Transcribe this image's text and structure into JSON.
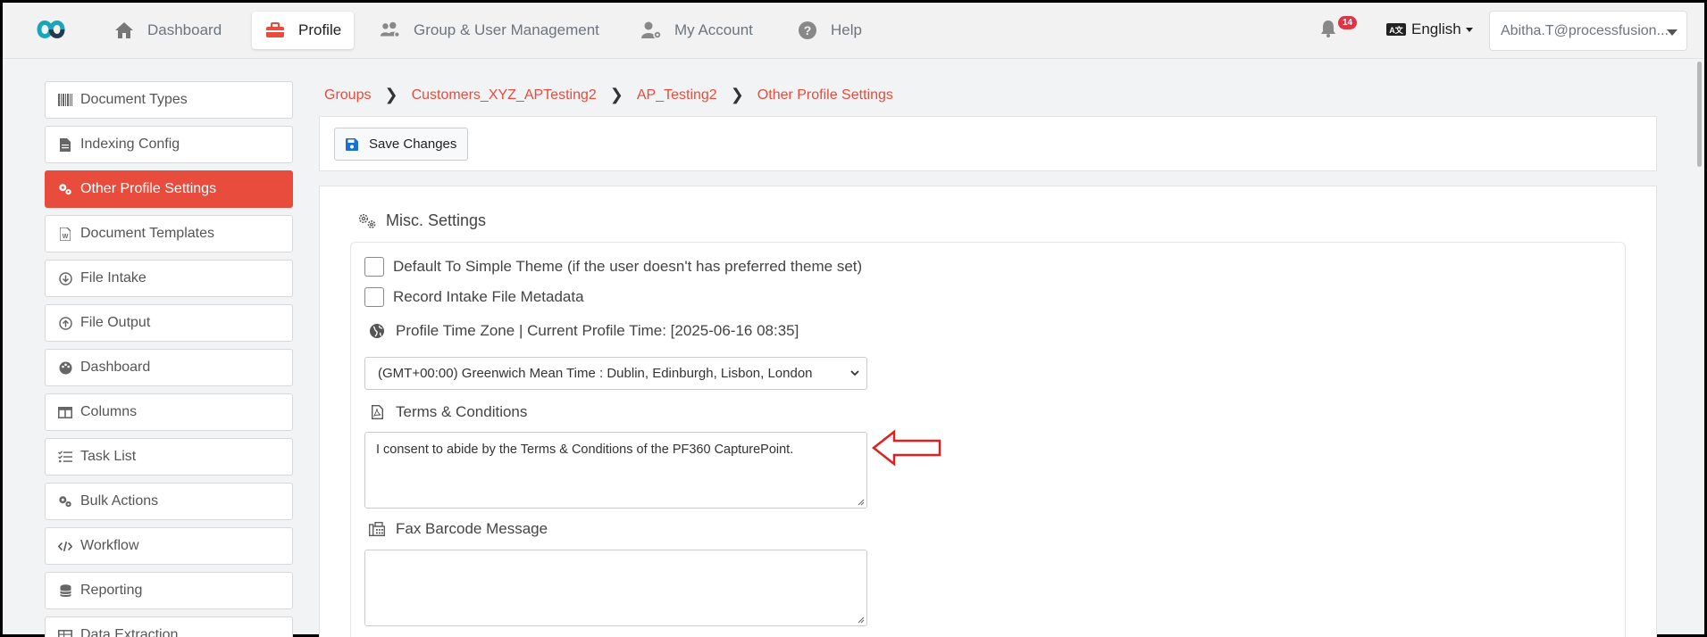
{
  "nav": {
    "items": [
      {
        "label": "Dashboard",
        "icon": "home-icon"
      },
      {
        "label": "Profile",
        "icon": "toolbox-icon",
        "active": true
      },
      {
        "label": "Group & User Management",
        "icon": "users-cog-icon"
      },
      {
        "label": "My Account",
        "icon": "user-cog-icon"
      },
      {
        "label": "Help",
        "icon": "question-circle-icon"
      }
    ],
    "notification_count": "14",
    "language": "English",
    "user": "Abitha.T@processfusion...",
    "brand_color": "#e74c3c"
  },
  "sidebar": {
    "items": [
      {
        "label": "Document Types",
        "icon": "barcode-icon"
      },
      {
        "label": "Indexing Config",
        "icon": "file-icon"
      },
      {
        "label": "Other Profile Settings",
        "icon": "cogs-icon",
        "active": true
      },
      {
        "label": "Document Templates",
        "icon": "file-word-icon"
      },
      {
        "label": "File Intake",
        "icon": "arrow-circle-down-icon"
      },
      {
        "label": "File Output",
        "icon": "arrow-circle-up-icon"
      },
      {
        "label": "Dashboard",
        "icon": "palette-icon"
      },
      {
        "label": "Columns",
        "icon": "columns-icon"
      },
      {
        "label": "Task List",
        "icon": "tasks-icon"
      },
      {
        "label": "Bulk Actions",
        "icon": "cogs-icon"
      },
      {
        "label": "Workflow",
        "icon": "code-icon"
      },
      {
        "label": "Reporting",
        "icon": "database-icon"
      },
      {
        "label": "Data Extraction",
        "icon": "table-icon"
      }
    ]
  },
  "breadcrumb": [
    "Groups",
    "Customers_XYZ_APTesting2",
    "AP_Testing2",
    "Other Profile Settings"
  ],
  "toolbar": {
    "save_label": "Save Changes"
  },
  "misc": {
    "title": "Misc. Settings",
    "checkbox_simple_theme": "Default To Simple Theme (if the user doesn't has preferred theme set)",
    "checkbox_record_metadata": "Record Intake File Metadata",
    "timezone_label": "Profile Time Zone | Current Profile Time: [2025-06-16 08:35]",
    "timezone_value": "(GMT+00:00) Greenwich Mean Time : Dublin, Edinburgh, Lisbon, London",
    "terms_label": "Terms & Conditions",
    "terms_value": "I consent to abide by the Terms & Conditions of the PF360 CapturePoint.",
    "fax_label": "Fax Barcode Message",
    "fax_value": ""
  }
}
